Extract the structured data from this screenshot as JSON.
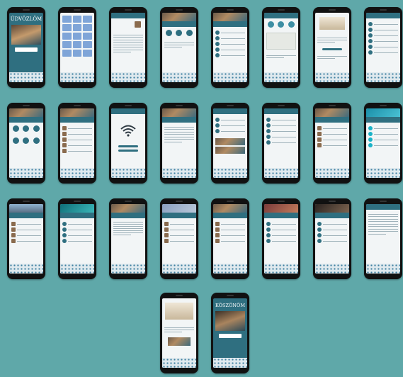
{
  "welcome_title": "ÜDVÖZLÖM",
  "thanks_title": "KÖSZÖNÖM",
  "colors": {
    "background": "#5fa8a9",
    "header": "#2f6f80",
    "phone_frame": "#111111"
  },
  "icons": {
    "wifi": "wifi-icon"
  }
}
